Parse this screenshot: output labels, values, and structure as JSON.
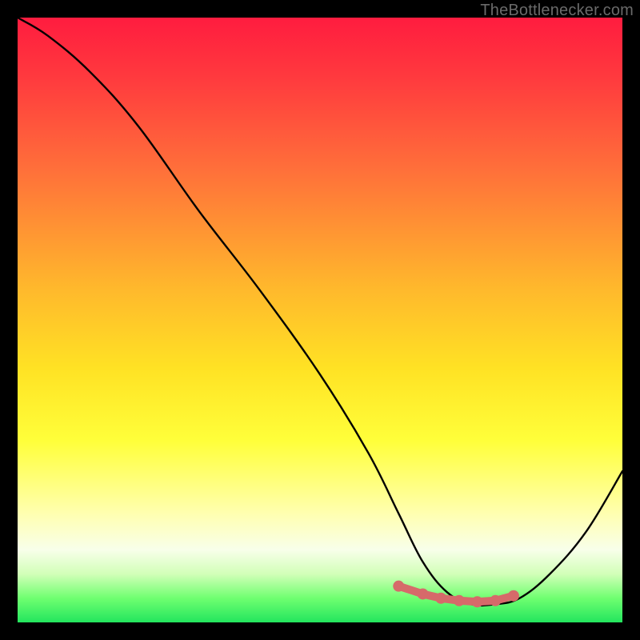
{
  "watermark": "TheBottlenecker.com",
  "colors": {
    "background_frame": "#000000",
    "curve_stroke": "#000000",
    "marker_fill": "#d66a6a",
    "marker_stroke": "#d66a6a"
  },
  "chart_data": {
    "type": "line",
    "title": "",
    "xlabel": "",
    "ylabel": "",
    "xlim": [
      0,
      100
    ],
    "ylim": [
      0,
      100
    ],
    "series": [
      {
        "name": "bottleneck-curve",
        "x": [
          0,
          5,
          12,
          20,
          30,
          40,
          50,
          58,
          63,
          67,
          71,
          75,
          79,
          83,
          88,
          94,
          100
        ],
        "values": [
          100,
          97,
          91,
          82,
          68,
          55,
          41,
          28,
          18,
          10,
          5,
          3,
          3,
          4,
          8,
          15,
          25
        ]
      }
    ],
    "markers": {
      "name": "optimal-zone-dots",
      "x": [
        63,
        67,
        70,
        73,
        76,
        79,
        82
      ],
      "values": [
        6.0,
        4.7,
        4.0,
        3.6,
        3.4,
        3.6,
        4.4
      ]
    }
  }
}
